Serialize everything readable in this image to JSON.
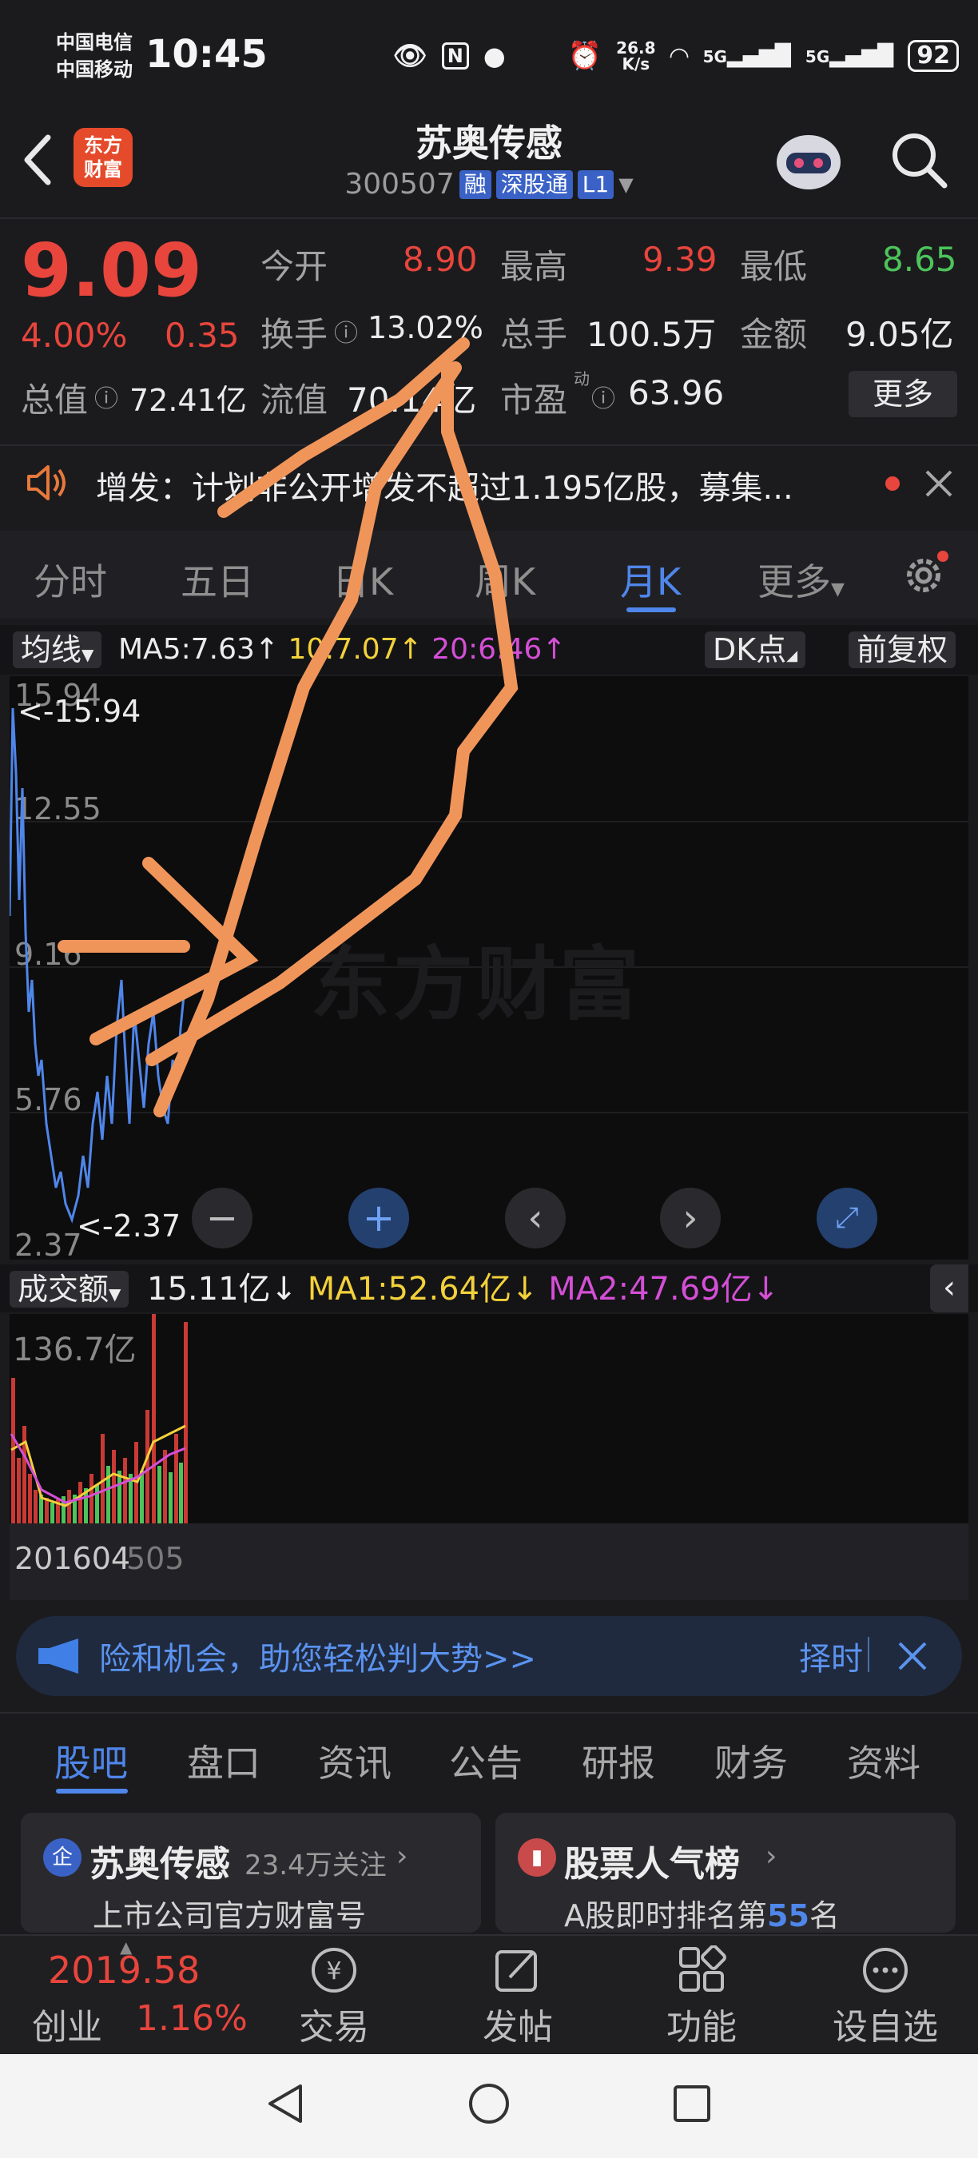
{
  "status_bar": {
    "carrier_1": "中国电信",
    "carrier_2": "中国移动",
    "time": "10:45",
    "speed": "26.8",
    "speed_unit": "K/s",
    "net_1": "5G",
    "net_2": "5G",
    "battery": "92"
  },
  "header": {
    "logo_line1": "东方",
    "logo_line2": "财富",
    "stock_name": "苏奥传感",
    "stock_code": "300507",
    "tag_margin": "融",
    "tag_connect": "深股通",
    "tag_level": "L1"
  },
  "quote": {
    "price": "9.09",
    "change_pct": "4.00%",
    "change": "0.35",
    "open_label": "今开",
    "open": "8.90",
    "high_label": "最高",
    "high": "9.39",
    "low_label": "最低",
    "low": "8.65",
    "turnover_label": "换手",
    "turnover": "13.02%",
    "volume_label": "总手",
    "volume": "100.5万",
    "amount_label": "金额",
    "amount": "9.05亿",
    "mktcap_label": "总值",
    "mktcap": "72.41亿",
    "float_label": "流值",
    "float_cap": "70.14亿",
    "pe_label": "市盈",
    "pe_sup": "动",
    "pe": "63.96",
    "more_label": "更多"
  },
  "notice": {
    "text": "增发：计划非公开增发不超过1.195亿股，募集..."
  },
  "chart_tabs": [
    {
      "label": "分时"
    },
    {
      "label": "五日"
    },
    {
      "label": "日K"
    },
    {
      "label": "周K"
    },
    {
      "label": "月K"
    },
    {
      "label": "更多"
    }
  ],
  "kline": {
    "ma_selector": "均线",
    "ma5": "MA5:7.63↑",
    "ma10": "10:7.07↑",
    "ma20": "20:6.46↑",
    "dk_label": "DK点",
    "adjust_label": "前复权",
    "y_ticks": [
      "15.94",
      "12.55",
      "9.16",
      "5.76",
      "2.37"
    ],
    "max_marker": "<-15.94",
    "min_marker": "<-2.37",
    "watermark": "东方财富"
  },
  "volume": {
    "selector": "成交额",
    "value": "15.11亿↓",
    "ma1": "MA1:52.64亿↓",
    "ma2": "MA2:47.69亿↓",
    "y_max": "136.7亿",
    "date_start": "201604",
    "date_end": "505"
  },
  "banner": {
    "text": "险和机会，助您轻松判大势>>",
    "action": "择时"
  },
  "bottom_tabs": [
    {
      "label": "股吧"
    },
    {
      "label": "盘口"
    },
    {
      "label": "资讯"
    },
    {
      "label": "公告"
    },
    {
      "label": "研报"
    },
    {
      "label": "财务"
    },
    {
      "label": "资料"
    }
  ],
  "cards": {
    "left_badge": "企",
    "left_title": "苏奥传感",
    "left_follow": "23.4万关注",
    "left_sub": "上市公司官方财富号",
    "right_title": "股票人气榜",
    "right_sub_prefix": "A股即时排名第",
    "right_rank": "55",
    "right_sub_suffix": "名"
  },
  "bottom_nav": {
    "index_value": "2019.58",
    "index_name": "创业",
    "index_pct": "1.16%",
    "trade": "交易",
    "post": "发帖",
    "functions": "功能",
    "watchlist": "设自选"
  },
  "colors": {
    "up": "#e8453c",
    "down": "#4cc45a",
    "accent": "#4f86ea",
    "ma10": "#f3d13a",
    "ma20": "#d44fd6",
    "annotation": "#f0955a"
  }
}
